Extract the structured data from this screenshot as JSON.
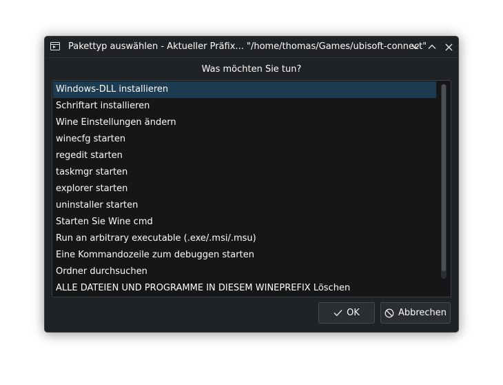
{
  "window": {
    "title": "Pakettyp auswählen - Aktueller Präfix... \"/home/thomas/Games/ubisoft-connect\"",
    "icon": "terminal-window-icon",
    "controls": [
      "minimize-icon",
      "maximize-icon",
      "close-icon"
    ]
  },
  "dialog": {
    "prompt": "Was möchten Sie tun?",
    "selected_index": 0,
    "items": [
      {
        "label": "Windows-DLL installieren"
      },
      {
        "label": "Schriftart installieren"
      },
      {
        "label": "Wine Einstellungen ändern"
      },
      {
        "label": "winecfg starten"
      },
      {
        "label": "regedit starten"
      },
      {
        "label": "taskmgr starten"
      },
      {
        "label": "explorer starten"
      },
      {
        "label": "uninstaller starten"
      },
      {
        "label": "Starten Sie Wine cmd"
      },
      {
        "label": "Run an arbitrary executable (.exe/.msi/.msu)"
      },
      {
        "label": "Eine Kommandozeile zum debuggen starten"
      },
      {
        "label": "Ordner durchsuchen"
      },
      {
        "label": "ALLE DATEIEN UND PROGRAMME IN DIESEM WINEPREFIX Löschen"
      }
    ],
    "scroll_visible_fraction": 0.96
  },
  "buttons": {
    "ok_label": "OK",
    "ok_icon": "checkmark-icon",
    "cancel_label": "Abbrechen",
    "cancel_icon": "cancel-icon"
  },
  "colors": {
    "background": "#202326",
    "selection": "#1d3c52",
    "text": "#fcfcfc"
  }
}
